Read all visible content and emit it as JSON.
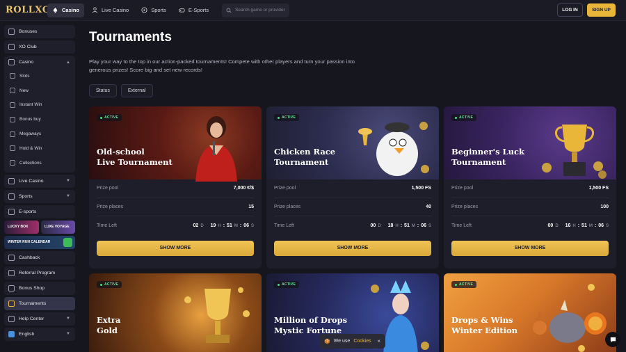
{
  "header": {
    "logo": "ROLLXO",
    "nav": [
      {
        "label": "Casino",
        "icon": "spade-icon",
        "active": true
      },
      {
        "label": "Live Casino",
        "icon": "dealer-icon",
        "active": false
      },
      {
        "label": "Sports",
        "icon": "ball-icon",
        "active": false
      },
      {
        "label": "E-Sports",
        "icon": "gamepad-icon",
        "active": false
      }
    ],
    "search_placeholder": "Search game or provider",
    "login": "LOG IN",
    "signup": "SIGN UP"
  },
  "sidebar": {
    "top_items": [
      {
        "label": "Bonuses"
      },
      {
        "label": "XO Club"
      }
    ],
    "casino_group": {
      "label": "Casino",
      "children": [
        {
          "label": "Slots"
        },
        {
          "label": "New"
        },
        {
          "label": "Instant Win"
        },
        {
          "label": "Bonus buy"
        },
        {
          "label": "Megaways"
        },
        {
          "label": "Hold & Win"
        },
        {
          "label": "Collections"
        }
      ]
    },
    "expandable": [
      {
        "label": "Live Casino"
      },
      {
        "label": "Sports"
      }
    ],
    "esports": "E-sports",
    "promos": {
      "lucky_box": "LUCKY BOX",
      "luxe_voyage": "LUXE VOYAGE",
      "winter_run": "WINTER RUN CALENDAR"
    },
    "bottom_items": [
      {
        "label": "Cashback"
      },
      {
        "label": "Referral Program"
      },
      {
        "label": "Bonus Shop"
      },
      {
        "label": "Tournaments"
      }
    ],
    "help_center": "Help Center",
    "language": "English"
  },
  "main": {
    "title": "Tournaments",
    "intro": "Play your way to the top in our action-packed tournaments! Compete with other players and turn your passion into generous prizes! Score big and set new records!",
    "filters": [
      "Status",
      "External"
    ],
    "labels": {
      "prize_pool": "Prize pool",
      "prize_places": "Prize places",
      "time_left": "Time Left",
      "show_more": "SHOW MORE",
      "active": "ACTIVE"
    },
    "cards": [
      {
        "title_l1": "Old-school",
        "title_l2": "Live Tournament",
        "prize_pool": "7,000 €/$",
        "prize_places": "15",
        "time": {
          "d": "02",
          "h": "19",
          "m": "51",
          "s": "06"
        }
      },
      {
        "title_l1": "Chicken Race",
        "title_l2": "Tournament",
        "prize_pool": "1,500 FS",
        "prize_places": "40",
        "time": {
          "d": "00",
          "h": "18",
          "m": "51",
          "s": "06"
        }
      },
      {
        "title_l1": "Beginner's Luck",
        "title_l2": "Tournament",
        "prize_pool": "1,500 FS",
        "prize_places": "100",
        "time": {
          "d": "00",
          "h": "16",
          "m": "51",
          "s": "06"
        }
      },
      {
        "title_l1": "Extra",
        "title_l2": "Gold"
      },
      {
        "title_l1": "Million of Drops",
        "title_l2": "Mystic Fortune"
      },
      {
        "title_l1": "Drops & Wins",
        "title_l2": "Winter Edition"
      }
    ],
    "units": {
      "d": "D",
      "h": "H",
      "m": "M",
      "s": "S"
    }
  },
  "cookie": {
    "text": "We use",
    "link": "Cookies",
    "close": "×"
  }
}
